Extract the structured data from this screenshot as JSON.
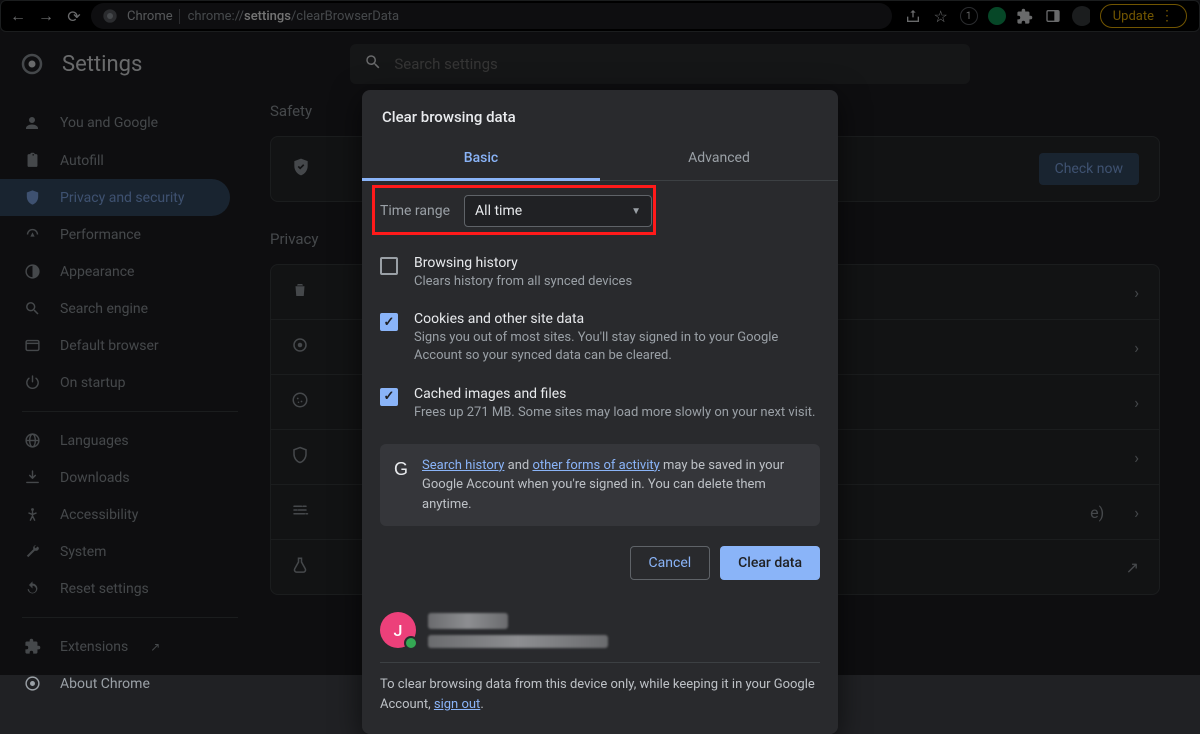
{
  "browser": {
    "app_label": "Chrome",
    "url_prefix": "chrome://",
    "url_bold": "settings",
    "url_rest": "/clearBrowserData",
    "badge_count": "1",
    "update_label": "Update"
  },
  "header": {
    "title": "Settings",
    "search_placeholder": "Search settings"
  },
  "sidebar": {
    "items": [
      {
        "label": "You and Google",
        "icon": "person"
      },
      {
        "label": "Autofill",
        "icon": "clipboard"
      },
      {
        "label": "Privacy and security",
        "icon": "shield"
      },
      {
        "label": "Performance",
        "icon": "speed"
      },
      {
        "label": "Appearance",
        "icon": "theme"
      },
      {
        "label": "Search engine",
        "icon": "search"
      },
      {
        "label": "Default browser",
        "icon": "window"
      },
      {
        "label": "On startup",
        "icon": "power"
      }
    ],
    "items2": [
      {
        "label": "Languages",
        "icon": "globe"
      },
      {
        "label": "Downloads",
        "icon": "download"
      },
      {
        "label": "Accessibility",
        "icon": "accessibility"
      },
      {
        "label": "System",
        "icon": "wrench"
      },
      {
        "label": "Reset settings",
        "icon": "restore"
      }
    ],
    "items3": [
      {
        "label": "Extensions",
        "icon": "puzzle",
        "external": true
      },
      {
        "label": "About Chrome",
        "icon": "chrome"
      }
    ]
  },
  "main": {
    "safety_label": "Safety",
    "check_now": "Check now",
    "privacy_label": "Privacy"
  },
  "dialog": {
    "title": "Clear browsing data",
    "tabs": {
      "basic": "Basic",
      "advanced": "Advanced"
    },
    "time_range_label": "Time range",
    "time_range_value": "All time",
    "options": [
      {
        "title": "Browsing history",
        "desc": "Clears history from all synced devices",
        "checked": false
      },
      {
        "title": "Cookies and other site data",
        "desc": "Signs you out of most sites. You'll stay signed in to your Google Account so your synced data can be cleared.",
        "checked": true
      },
      {
        "title": "Cached images and files",
        "desc": "Frees up 271 MB. Some sites may load more slowly on your next visit.",
        "checked": true
      }
    ],
    "info": {
      "link1": "Search history",
      "middle1": " and ",
      "link2": "other forms of activity",
      "rest": " may be saved in your Google Account when you're signed in. You can delete them anytime."
    },
    "cancel": "Cancel",
    "clear": "Clear data",
    "avatar_letter": "J",
    "footer_prefix": "To clear browsing data from this device only, while keeping it in your Google Account, ",
    "footer_link": "sign out",
    "footer_suffix": "."
  }
}
